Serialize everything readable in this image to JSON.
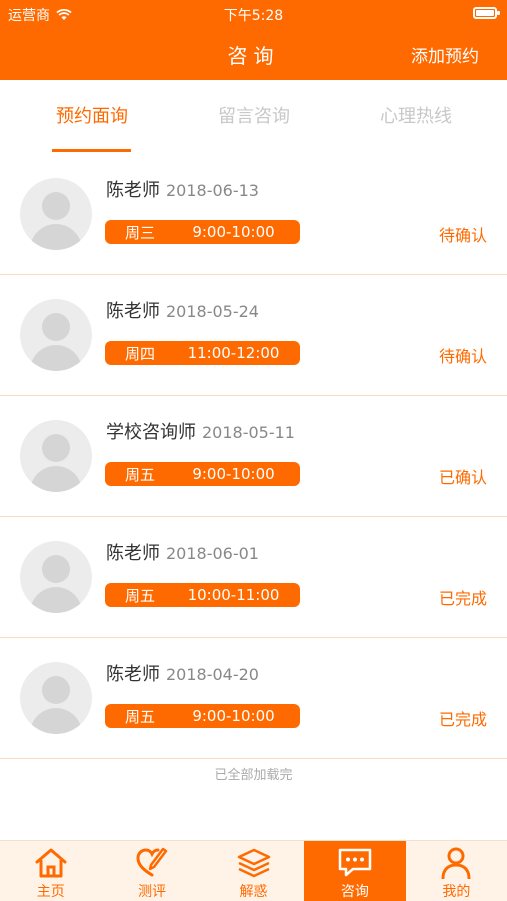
{
  "status_bar": {
    "carrier": "运营商",
    "time": "下午5:28"
  },
  "nav": {
    "title": "咨询",
    "action": "添加预约"
  },
  "tabs": [
    {
      "label": "预约面询",
      "active": true
    },
    {
      "label": "留言咨询",
      "active": false
    },
    {
      "label": "心理热线",
      "active": false
    }
  ],
  "appointments": [
    {
      "name": "陈老师",
      "date": "2018-06-13",
      "day": "周三",
      "time": "9:00-10:00",
      "status": "待确认"
    },
    {
      "name": "陈老师",
      "date": "2018-05-24",
      "day": "周四",
      "time": "11:00-12:00",
      "status": "待确认"
    },
    {
      "name": "学校咨询师",
      "date": "2018-05-11",
      "day": "周五",
      "time": "9:00-10:00",
      "status": "已确认"
    },
    {
      "name": "陈老师",
      "date": "2018-06-01",
      "day": "周五",
      "time": "10:00-11:00",
      "status": "已完成"
    },
    {
      "name": "陈老师",
      "date": "2018-04-20",
      "day": "周五",
      "time": "9:00-10:00",
      "status": "已完成"
    }
  ],
  "list_end": "已全部加载完",
  "bottom_tabs": [
    {
      "label": "主页",
      "icon": "home-icon"
    },
    {
      "label": "测评",
      "icon": "pen-icon"
    },
    {
      "label": "解惑",
      "icon": "layers-icon"
    },
    {
      "label": "咨询",
      "icon": "chat-icon",
      "active": true
    },
    {
      "label": "我的",
      "icon": "user-icon"
    }
  ],
  "colors": {
    "accent": "#ff6a00",
    "inactive_tab": "#c8c8c8",
    "tabbar_bg": "#fff3e8"
  }
}
